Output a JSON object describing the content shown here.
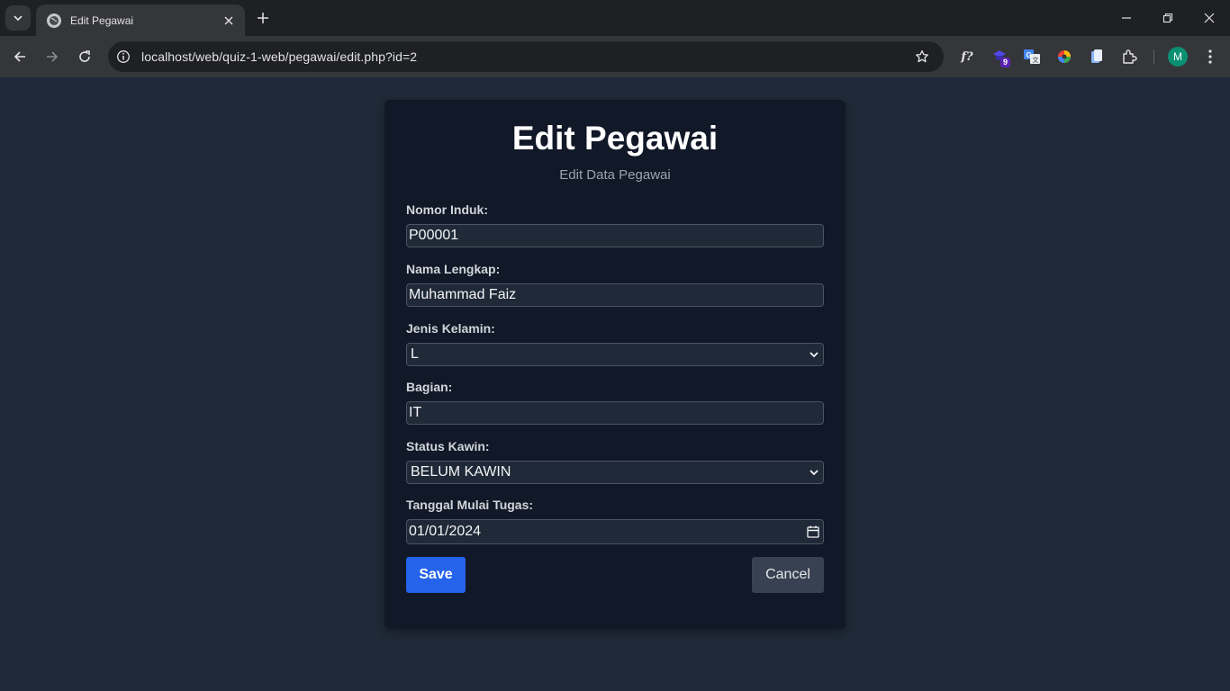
{
  "browser": {
    "tab_title": "Edit Pegawai",
    "url": "localhost/web/quiz-1-web/pegawai/edit.php?id=2",
    "extension_badge": "9",
    "profile_initial": "M"
  },
  "page": {
    "title": "Edit Pegawai",
    "subtitle": "Edit Data Pegawai",
    "fields": {
      "nomor_induk": {
        "label": "Nomor Induk:",
        "value": "P00001"
      },
      "nama_lengkap": {
        "label": "Nama Lengkap:",
        "value": "Muhammad Faiz"
      },
      "jenis_kelamin": {
        "label": "Jenis Kelamin:",
        "value": "L"
      },
      "bagian": {
        "label": "Bagian:",
        "value": "IT"
      },
      "status_kawin": {
        "label": "Status Kawin:",
        "value": "BELUM KAWIN"
      },
      "tanggal_mulai": {
        "label": "Tanggal Mulai Tugas:",
        "value": "01/01/2024"
      }
    },
    "save_label": "Save",
    "cancel_label": "Cancel"
  },
  "colors": {
    "page_bg": "#1f2937",
    "card_bg": "#111827",
    "input_bg": "#1f2937",
    "save_button": "#2563eb",
    "cancel_button": "#374151"
  }
}
